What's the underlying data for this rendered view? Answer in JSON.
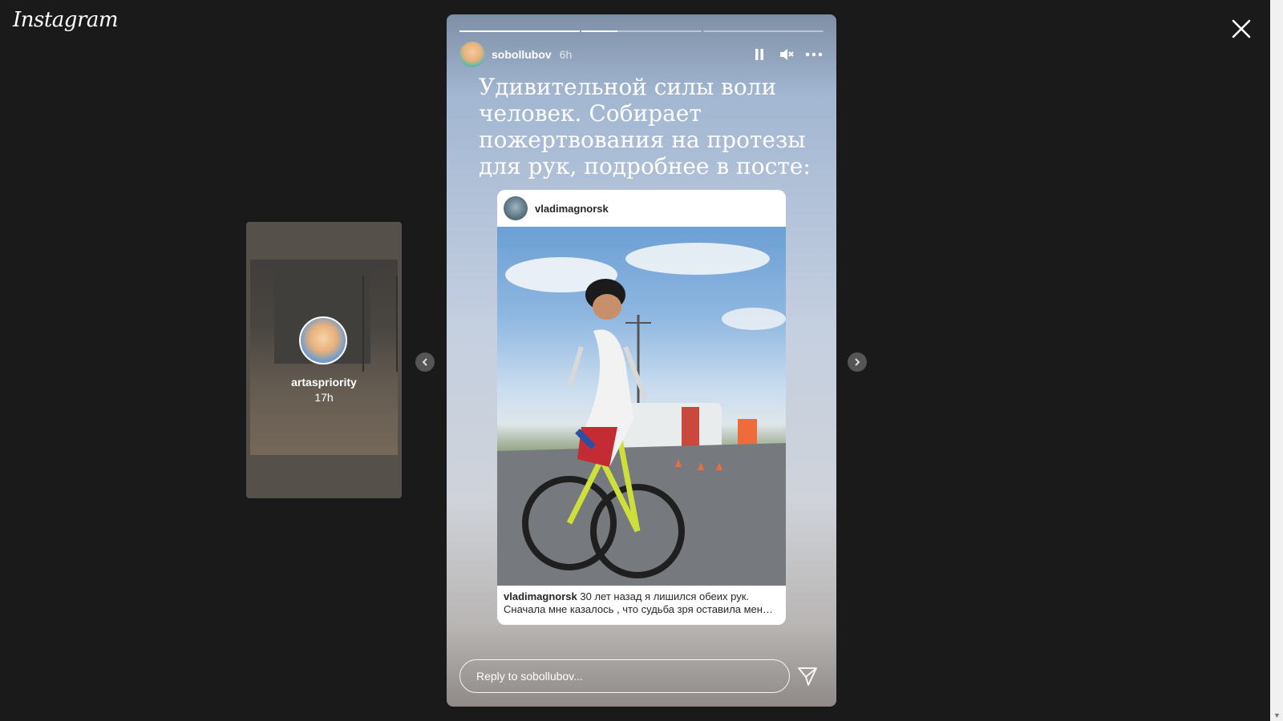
{
  "app": {
    "logo": "Instagram"
  },
  "preview": {
    "username": "artaspriority",
    "time": "17h"
  },
  "story": {
    "username": "sobollubov",
    "time": "6h",
    "progress": [
      1.0,
      0.3,
      0.0
    ],
    "text": "Удивительной силы воли человек. Собирает пожертвования на протезы для рук, подробнее в посте:",
    "post": {
      "username": "vladimagnorsk",
      "caption_user": "vladimagnorsk",
      "caption_text": "30 лет назад я лишился обеих рук.",
      "caption_line2": "Сначала мне казалось , что судьба зря оставила мен…"
    },
    "reply_placeholder": "Reply to sobollubov..."
  },
  "icons": {
    "close": "close-icon",
    "pause": "pause-icon",
    "mute": "volume-muted-icon",
    "more": "more-icon",
    "send": "send-icon",
    "prev": "chevron-left-icon",
    "next": "chevron-right-icon"
  }
}
